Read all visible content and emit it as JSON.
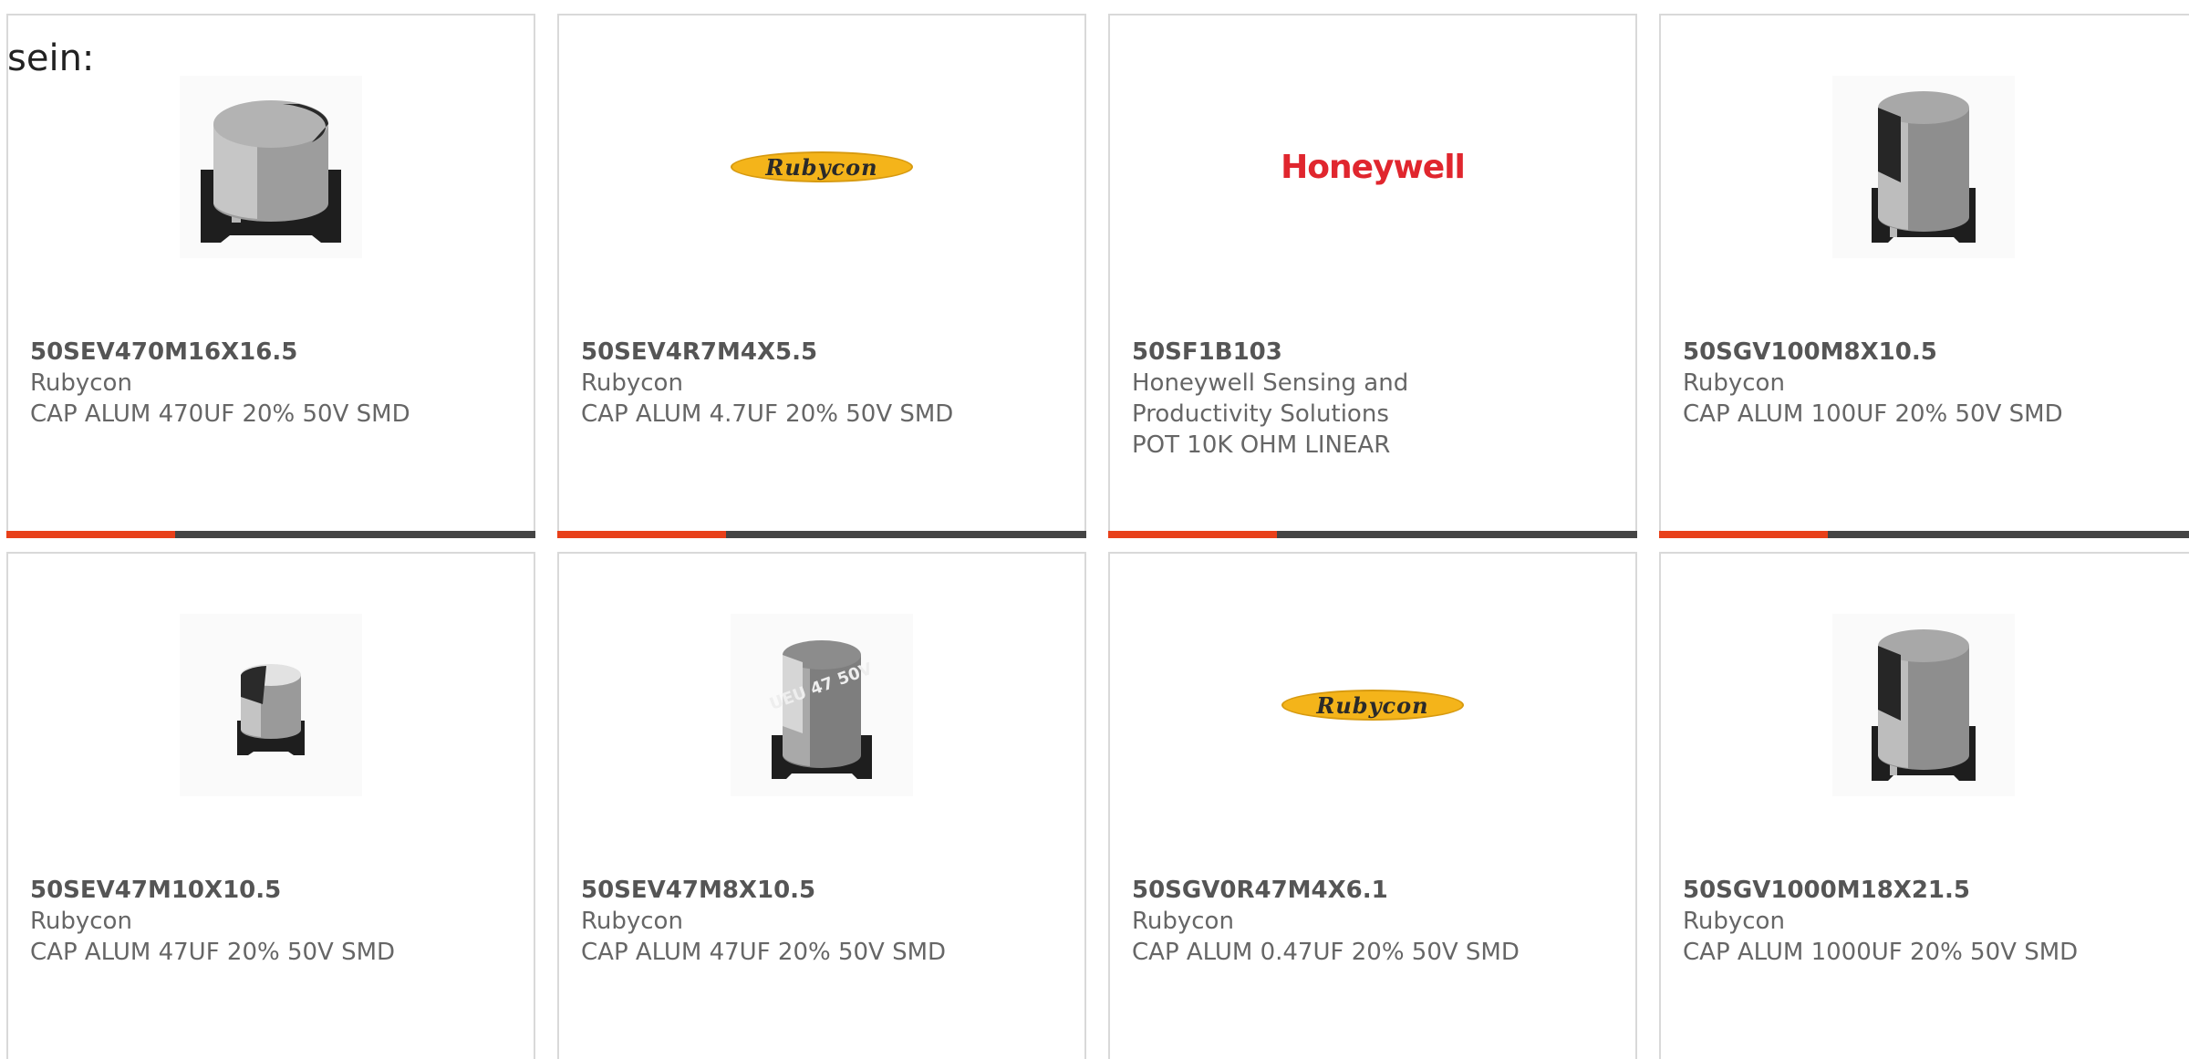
{
  "lead_text": "sein:",
  "colors": {
    "accent": "#e8401a",
    "bar": "#444444",
    "border": "#d9d9d9",
    "hw_red": "#e0262e",
    "rubycon_yellow": "#f4b41a"
  },
  "products": [
    {
      "part": "50SEV470M16X16.5",
      "maker": "Rubycon",
      "desc": "CAP ALUM 470UF 20% 50V SMD",
      "image": "capacitor-photo"
    },
    {
      "part": "50SEV4R7M4X5.5",
      "maker": "Rubycon",
      "desc": "CAP ALUM 4.7UF 20% 50V SMD",
      "image": "rubycon-logo",
      "logo_text": "Rubycon"
    },
    {
      "part": "50SF1B103",
      "maker": "Honeywell Sensing and Productivity Solutions",
      "desc": "POT 10K OHM LINEAR",
      "image": "honeywell-logo",
      "logo_text": "Honeywell"
    },
    {
      "part": "50SGV100M8X10.5",
      "maker": "Rubycon",
      "desc": "CAP ALUM 100UF 20% 50V SMD",
      "image": "capacitor-photo"
    },
    {
      "part": "50SEV47M10X10.5",
      "maker": "Rubycon",
      "desc": "CAP ALUM 47UF 20% 50V SMD",
      "image": "capacitor-photo"
    },
    {
      "part": "50SEV47M8X10.5",
      "maker": "Rubycon",
      "desc": "CAP ALUM 47UF 20% 50V SMD",
      "image": "capacitor-photo",
      "cap_marking": "UEU 47 50V"
    },
    {
      "part": "50SGV0R47M4X6.1",
      "maker": "Rubycon",
      "desc": "CAP ALUM 0.47UF 20% 50V SMD",
      "image": "rubycon-logo",
      "logo_text": "Rubycon"
    },
    {
      "part": "50SGV1000M18X21.5",
      "maker": "Rubycon",
      "desc": "CAP ALUM 1000UF 20% 50V SMD",
      "image": "capacitor-photo"
    }
  ]
}
